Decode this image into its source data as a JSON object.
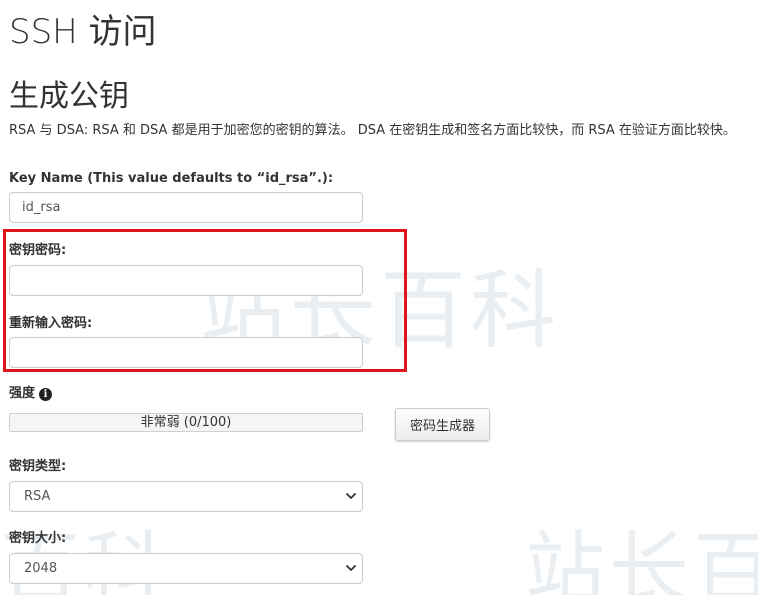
{
  "page": {
    "title": "SSH 访问"
  },
  "generate_key": {
    "section_title": "生成公钥",
    "description": "RSA 与 DSA: RSA 和 DSA 都是用于加密您的密钥的算法。 DSA 在密钥生成和签名方面比较快，而 RSA 在验证方面比较快。",
    "key_name": {
      "label": "Key Name (This value defaults to “id_rsa”.):",
      "value": "id_rsa"
    },
    "password": {
      "label": "密钥密码:",
      "value": ""
    },
    "password_confirm": {
      "label": "重新输入密码:",
      "value": ""
    },
    "strength": {
      "label": "强度",
      "text": "非常弱 (0/100)",
      "value": 0,
      "max": 100
    },
    "generator_button": "密码生成器",
    "key_type": {
      "label": "密钥类型:",
      "selected": "RSA"
    },
    "key_size": {
      "label": "密钥大小:",
      "selected": "2048"
    }
  },
  "watermark": {
    "text": "站长百科"
  },
  "colors": {
    "highlight": "#e0141b",
    "text": "#333333",
    "border": "#cccccc"
  },
  "icons": {
    "strength_info": "info-circle-icon",
    "select_arrow": "chevron-down-icon"
  }
}
